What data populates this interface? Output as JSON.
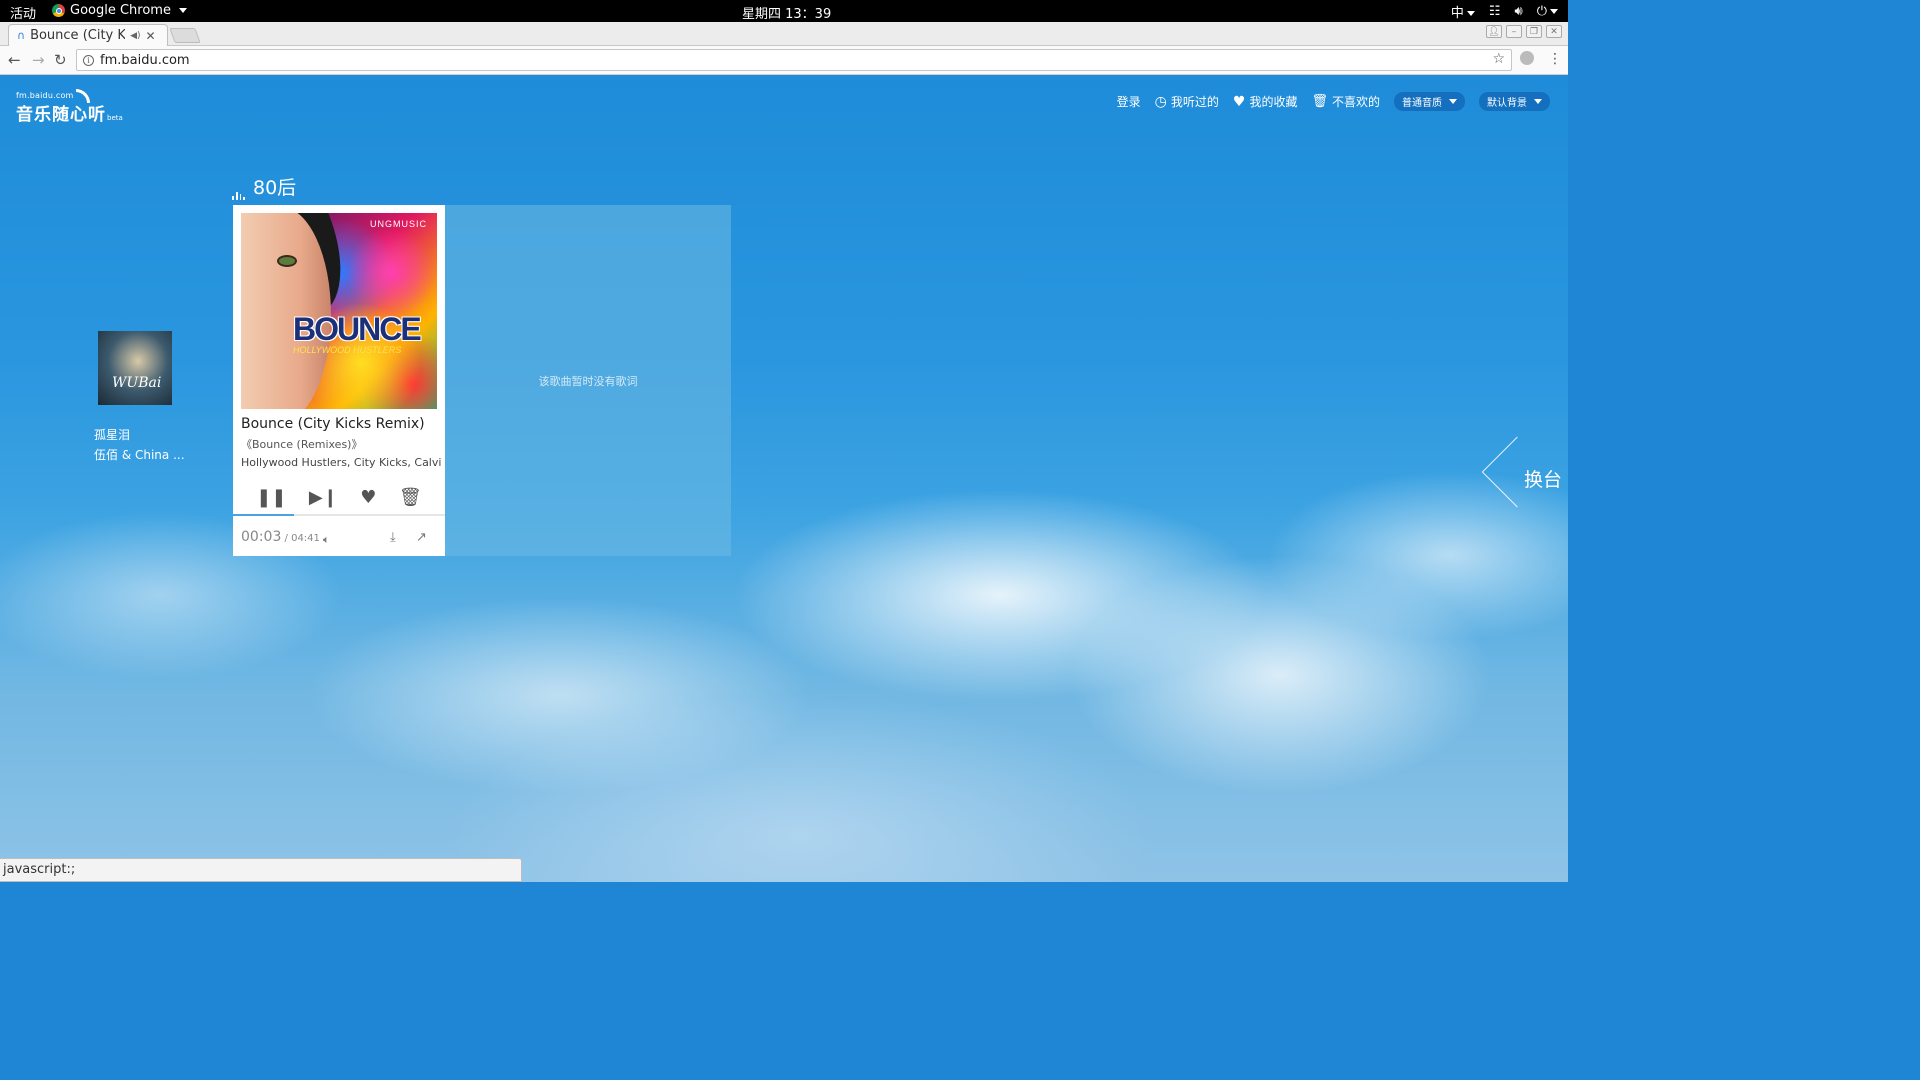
{
  "topbar": {
    "activities": "活动",
    "app_name": "Google Chrome",
    "clock": "星期四 13：39",
    "input_method": "中"
  },
  "browser": {
    "tab_title": "Bounce (City Kic",
    "url": "fm.baidu.com",
    "status_text": "javascript:;"
  },
  "site": {
    "logo_small": "fm.baidu.com",
    "logo_big": "音乐随心听",
    "logo_beta": "beta",
    "nav": {
      "login": "登录",
      "history": "我听过的",
      "favorites": "我的收藏",
      "disliked": "不喜欢的",
      "quality": "普通音质",
      "background": "默认背景"
    },
    "channel_name": "80后",
    "switch_channel": "换台"
  },
  "player": {
    "cover": {
      "label": "UNGMUSIC",
      "title": "BOUNCE",
      "subtitle": "HOLLYWOOD HUSTLERS"
    },
    "song_title": "Bounce (City Kicks Remix)",
    "album": "《Bounce (Remixes)》",
    "artists": "Hollywood Hustlers, City Kicks, Calvi...",
    "elapsed": "00:03",
    "total": " / 04:41",
    "progress_fraction": 0.29,
    "lyrics_placeholder": "该歌曲暂时没有歌词"
  },
  "previous": {
    "title": "孤星泪",
    "artist": "伍佰 & China ...",
    "cover_text": "WUBai"
  },
  "colors": {
    "accent": "#4aa3df",
    "sky_top": "#1f8cd9",
    "sky_bottom": "#8fc3e6"
  }
}
